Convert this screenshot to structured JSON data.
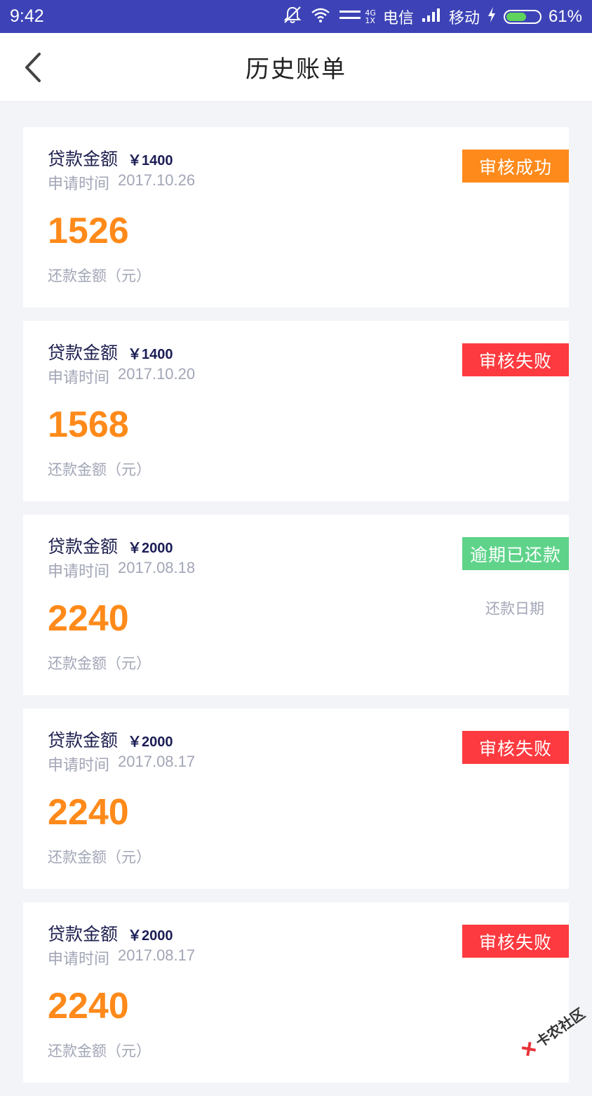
{
  "status_bar": {
    "time": "9:42",
    "net_top": "4G",
    "net_bottom": "1X",
    "carrier1": "电信",
    "carrier2": "移动",
    "battery_level": 0.61,
    "battery": "61%",
    "icons": [
      "mute-icon",
      "wifi-icon",
      "signal-icon",
      "charging-icon"
    ],
    "bg_color": "#3d43b6"
  },
  "header": {
    "title": "历史账单",
    "back_icon": "chevron-left-icon"
  },
  "bills": [
    {
      "loan_label": "贷款金额",
      "loan_amount": "￥1400",
      "apply_label": "申请时间",
      "apply_date": "2017.10.26",
      "repay_amount": "1526",
      "repay_label": "还款金额（元）",
      "status": "审核成功",
      "status_color": "#fe8a1b",
      "repay_date_label": ""
    },
    {
      "loan_label": "贷款金额",
      "loan_amount": "￥1400",
      "apply_label": "申请时间",
      "apply_date": "2017.10.20",
      "repay_amount": "1568",
      "repay_label": "还款金额（元）",
      "status": "审核失败",
      "status_color": "#fd3a3f",
      "repay_date_label": ""
    },
    {
      "loan_label": "贷款金额",
      "loan_amount": "￥2000",
      "apply_label": "申请时间",
      "apply_date": "2017.08.18",
      "repay_amount": "2240",
      "repay_label": "还款金额（元）",
      "status": "逾期已还款",
      "status_color": "#5fd38a",
      "repay_date_label": "还款日期"
    },
    {
      "loan_label": "贷款金额",
      "loan_amount": "￥2000",
      "apply_label": "申请时间",
      "apply_date": "2017.08.17",
      "repay_amount": "2240",
      "repay_label": "还款金额（元）",
      "status": "审核失败",
      "status_color": "#fd3a3f",
      "repay_date_label": ""
    },
    {
      "loan_label": "贷款金额",
      "loan_amount": "￥2000",
      "apply_label": "申请时间",
      "apply_date": "2017.08.17",
      "repay_amount": "2240",
      "repay_label": "还款金额（元）",
      "status": "审核失败",
      "status_color": "#fd3a3f",
      "repay_date_label": ""
    }
  ],
  "colors": {
    "accent_orange": "#ff8a1a",
    "title_navy": "#1f2150",
    "muted_gray": "#a2a6b6"
  },
  "watermark": {
    "text": "卡农社区"
  }
}
